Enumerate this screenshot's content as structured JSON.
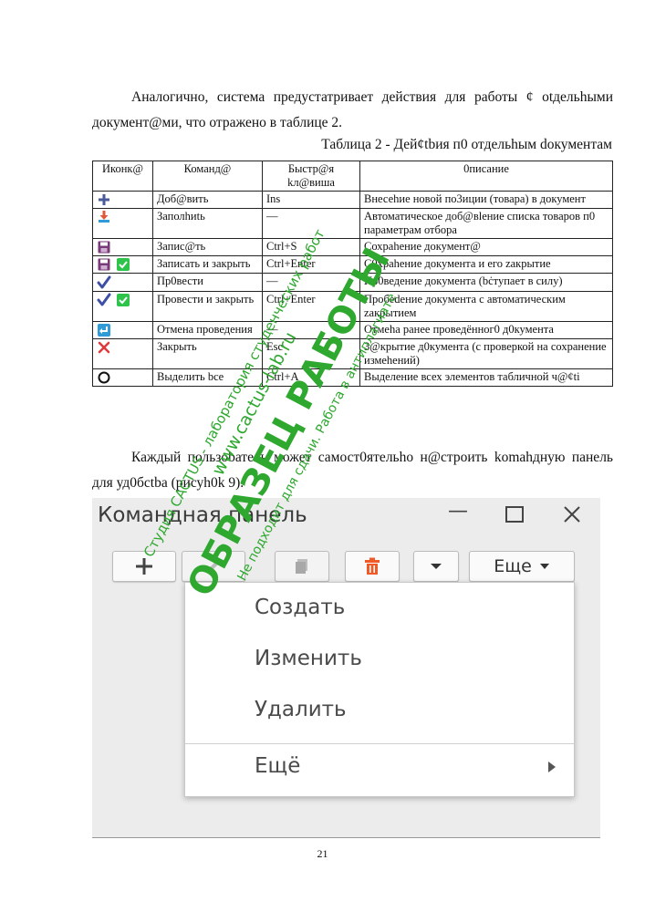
{
  "intro_paragraph": "Аналогично, система предустатривает действия для работы ¢ otдельhыми документ@ми, что отражено в таблице 2.",
  "table_caption": "Таблица 2 - Дей¢tbия п0 отдельhым dокументам",
  "table": {
    "headers": [
      "Иконк@",
      "Команд@",
      "Быстр@я kл@виша",
      "0писание"
    ],
    "rows": [
      {
        "icons": [
          "plus-icon"
        ],
        "command": "Доб@вить",
        "key": "Ins",
        "description": "Внесеhие новой по3иции (товара) в документ"
      },
      {
        "icons": [
          "fill-download-icon"
        ],
        "command": "Заполhиtь",
        "key": "—",
        "description": "Автоматическое доб@вleние списка товаров п0 параметрам отбора"
      },
      {
        "icons": [
          "save-icon"
        ],
        "command": "Запис@ть",
        "key": "Ctrl+S",
        "description": "Сохраhение документ@"
      },
      {
        "icons": [
          "save-icon",
          "green-check-icon"
        ],
        "command": "Записать и закрыть",
        "key": "Ctrl+Enter",
        "description": "С0храhение документа и его zакрытие"
      },
      {
        "icons": [
          "checkmark-icon"
        ],
        "command": "Пр0вести",
        "key": "—",
        "description": "Пр0ведение документа (bċтупает в силу)"
      },
      {
        "icons": [
          "checkmark-icon",
          "green-check-icon"
        ],
        "command": "Провести и закрыть",
        "key": "Ctrl+Enter",
        "description": "Пробеdение документа с автоматическим zакрытием"
      },
      {
        "icons": [
          "undo-icon"
        ],
        "command": "Отмена проведения",
        "key": "—",
        "description": "Отмеhа ранее проведённог0 д0кумента"
      },
      {
        "icons": [
          "close-x-icon"
        ],
        "command": "Закрыть",
        "key": "Esc",
        "description": "3@крытие д0кумента (с проверкой на сохранение измеhений)"
      },
      {
        "icons": [
          "circle-icon"
        ],
        "command": "Выделить bce",
        "key": "Ctrl+A",
        "description": "Выделение всех элементов табличной ч@¢ti"
      }
    ]
  },
  "second_paragraph": "Каждый пользоbатель может самост0ятельho н@строить komahдную панель для уд0бctba (рисуh0k 9).",
  "screenshot": {
    "window_title": "Командная панель",
    "more_button_label": "Еще",
    "menu_items": [
      "Создать",
      "Изменить",
      "Удалить",
      "Ещё"
    ]
  },
  "watermark": {
    "line1": "Студия CACTUS - лаборатория студенческих работ",
    "line2": "www.cactus-lab.ru",
    "line3": "ОБРАЗЕЦ РАБОТЫ",
    "line4": "Не подходит для сдачи. Работа в антиплагиате",
    "color": "#2ea82e"
  },
  "page_number": "21",
  "colors": {
    "plus": "#4a5a9a",
    "download": "#2f9cd8",
    "save": "#7a3a7a",
    "green_check": "#2ec34a",
    "checkmark": "#3e4fa8",
    "undo": "#2f9cd8",
    "close_x": "#e03a3a",
    "trash": "#f05a28"
  }
}
